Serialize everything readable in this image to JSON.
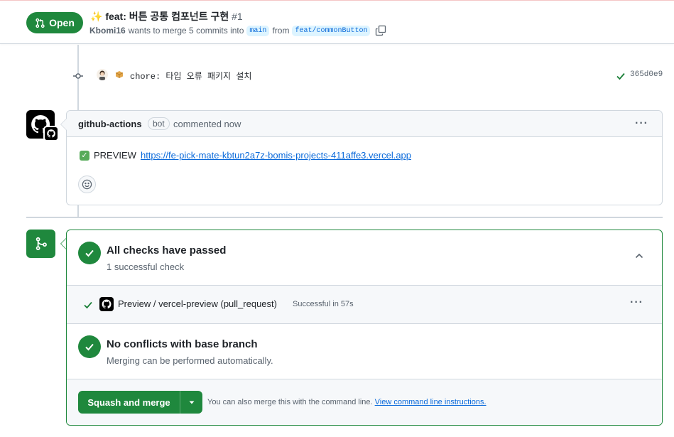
{
  "header": {
    "state": "Open",
    "title": "✨ feat: 버튼 공통 컴포넌트 구현",
    "number": "#1",
    "author": "Kbomi16",
    "merge_text": "wants to merge 5 commits into",
    "base_branch": "main",
    "from_text": "from",
    "head_branch": "feat/commonButton"
  },
  "commit": {
    "message": "chore: 타입 오류 패키지 설치",
    "sha": "365d0e9"
  },
  "comment": {
    "author": "github-actions",
    "badge": "bot",
    "time": "commented now",
    "body_label": "PREVIEW",
    "link": "https://fe-pick-mate-kbtun2a7z-bomis-projects-411affe3.vercel.app"
  },
  "merge_box": {
    "checks_title": "All checks have passed",
    "checks_sub": "1 successful check",
    "check_name": "Preview / vercel-preview (pull_request)",
    "check_status": "Successful in 57s",
    "conflicts_title": "No conflicts with base branch",
    "conflicts_sub": "Merging can be performed automatically.",
    "merge_button": "Squash and merge",
    "cli_text": "You can also merge this with the command line.",
    "cli_link": "View command line instructions."
  },
  "colors": {
    "success": "#1f883d",
    "link": "#0969da",
    "muted": "#59636e"
  }
}
